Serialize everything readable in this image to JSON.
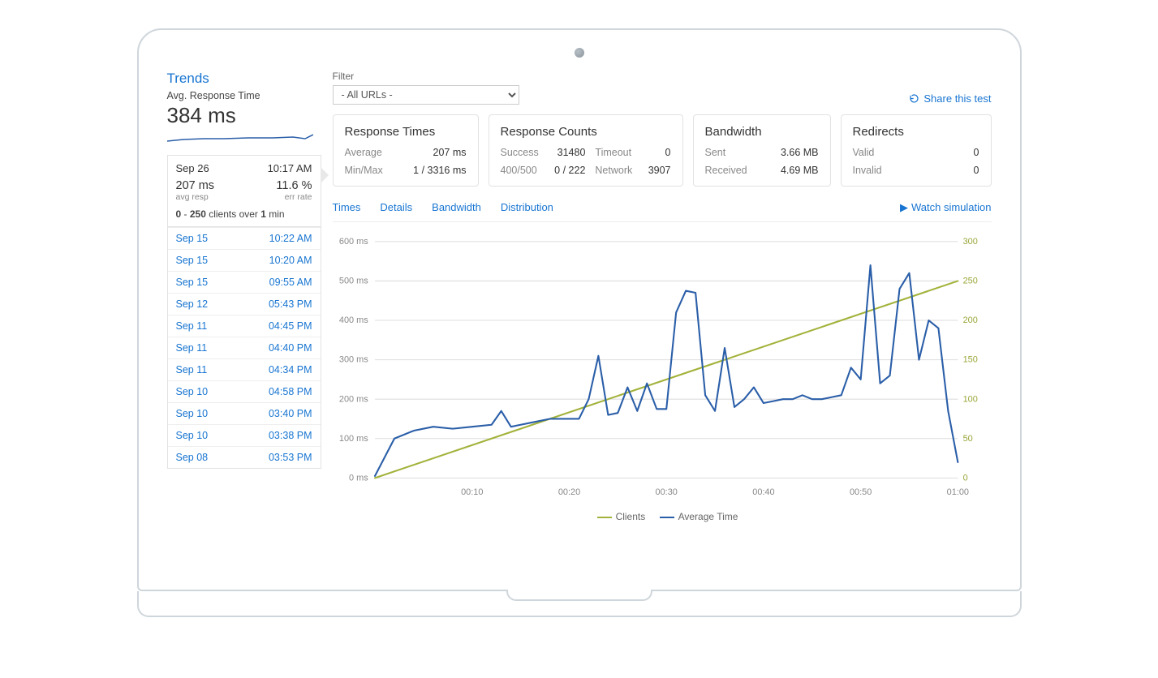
{
  "sidebar": {
    "title": "Trends",
    "avg_label": "Avg. Response Time",
    "avg_value": "384 ms",
    "selected": {
      "date": "Sep 26",
      "time": "10:17 AM",
      "resp_value": "207 ms",
      "resp_label": "avg resp",
      "err_value": "11.6 %",
      "err_label": "err rate",
      "clients_prefix": "0",
      "clients_dash": "  -  ",
      "clients_count": "250",
      "clients_mid": " clients over ",
      "clients_duration": "1",
      "clients_unit": " min"
    },
    "history": [
      {
        "date": "Sep 15",
        "time": "10:22 AM"
      },
      {
        "date": "Sep 15",
        "time": "10:20 AM"
      },
      {
        "date": "Sep 15",
        "time": "09:55 AM"
      },
      {
        "date": "Sep 12",
        "time": "05:43 PM"
      },
      {
        "date": "Sep 11",
        "time": "04:45 PM"
      },
      {
        "date": "Sep 11",
        "time": "04:40 PM"
      },
      {
        "date": "Sep 11",
        "time": "04:34 PM"
      },
      {
        "date": "Sep 10",
        "time": "04:58 PM"
      },
      {
        "date": "Sep 10",
        "time": "03:40 PM"
      },
      {
        "date": "Sep 10",
        "time": "03:38 PM"
      },
      {
        "date": "Sep 08",
        "time": "03:53 PM"
      }
    ]
  },
  "filter": {
    "label": "Filter",
    "selected": "- All URLs -"
  },
  "share_label": "Share this test",
  "cards": {
    "response_times": {
      "title": "Response Times",
      "rows": [
        {
          "k": "Average",
          "v": "207 ms"
        },
        {
          "k": "Min/Max",
          "v": "1 / 3316 ms"
        }
      ]
    },
    "response_counts": {
      "title": "Response Counts",
      "rows": [
        {
          "k": "Success",
          "v": "31480",
          "k2": "Timeout",
          "v2": "0"
        },
        {
          "k": "400/500",
          "v": "0 / 222",
          "k2": "Network",
          "v2": "3907"
        }
      ]
    },
    "bandwidth": {
      "title": "Bandwidth",
      "rows": [
        {
          "k": "Sent",
          "v": "3.66 MB"
        },
        {
          "k": "Received",
          "v": "4.69 MB"
        }
      ]
    },
    "redirects": {
      "title": "Redirects",
      "rows": [
        {
          "k": "Valid",
          "v": "0"
        },
        {
          "k": "Invalid",
          "v": "0"
        }
      ]
    }
  },
  "tabs": [
    "Times",
    "Details",
    "Bandwidth",
    "Distribution"
  ],
  "watch_label": "Watch simulation",
  "legend": {
    "clients": "Clients",
    "avg": "Average Time"
  },
  "chart_data": {
    "type": "line",
    "x_ticks": [
      "00:10",
      "00:20",
      "00:30",
      "00:40",
      "00:50",
      "01:00"
    ],
    "y_left_label_unit": "ms",
    "y_left_ticks": [
      0,
      100,
      200,
      300,
      400,
      500,
      600
    ],
    "y_right_ticks": [
      0,
      50,
      100,
      150,
      200,
      250,
      300
    ],
    "series": [
      {
        "name": "Clients",
        "axis": "right",
        "color": "#a3b23a",
        "points": [
          {
            "x": 0,
            "y": 0
          },
          {
            "x": 60,
            "y": 250
          }
        ]
      },
      {
        "name": "Average Time",
        "axis": "left",
        "color": "#2a5ea8",
        "points": [
          {
            "x": 0,
            "y": 5
          },
          {
            "x": 2,
            "y": 100
          },
          {
            "x": 4,
            "y": 120
          },
          {
            "x": 6,
            "y": 130
          },
          {
            "x": 8,
            "y": 125
          },
          {
            "x": 10,
            "y": 130
          },
          {
            "x": 12,
            "y": 135
          },
          {
            "x": 13,
            "y": 170
          },
          {
            "x": 14,
            "y": 130
          },
          {
            "x": 15,
            "y": 135
          },
          {
            "x": 16,
            "y": 140
          },
          {
            "x": 17,
            "y": 145
          },
          {
            "x": 18,
            "y": 150
          },
          {
            "x": 19,
            "y": 150
          },
          {
            "x": 20,
            "y": 150
          },
          {
            "x": 21,
            "y": 150
          },
          {
            "x": 22,
            "y": 200
          },
          {
            "x": 23,
            "y": 310
          },
          {
            "x": 24,
            "y": 160
          },
          {
            "x": 25,
            "y": 165
          },
          {
            "x": 26,
            "y": 230
          },
          {
            "x": 27,
            "y": 170
          },
          {
            "x": 28,
            "y": 240
          },
          {
            "x": 29,
            "y": 175
          },
          {
            "x": 30,
            "y": 175
          },
          {
            "x": 31,
            "y": 420
          },
          {
            "x": 32,
            "y": 475
          },
          {
            "x": 33,
            "y": 470
          },
          {
            "x": 34,
            "y": 210
          },
          {
            "x": 35,
            "y": 170
          },
          {
            "x": 36,
            "y": 330
          },
          {
            "x": 37,
            "y": 180
          },
          {
            "x": 38,
            "y": 200
          },
          {
            "x": 39,
            "y": 230
          },
          {
            "x": 40,
            "y": 190
          },
          {
            "x": 41,
            "y": 195
          },
          {
            "x": 42,
            "y": 200
          },
          {
            "x": 43,
            "y": 200
          },
          {
            "x": 44,
            "y": 210
          },
          {
            "x": 45,
            "y": 200
          },
          {
            "x": 46,
            "y": 200
          },
          {
            "x": 47,
            "y": 205
          },
          {
            "x": 48,
            "y": 210
          },
          {
            "x": 49,
            "y": 280
          },
          {
            "x": 50,
            "y": 250
          },
          {
            "x": 51,
            "y": 540
          },
          {
            "x": 52,
            "y": 240
          },
          {
            "x": 53,
            "y": 260
          },
          {
            "x": 54,
            "y": 480
          },
          {
            "x": 55,
            "y": 520
          },
          {
            "x": 56,
            "y": 300
          },
          {
            "x": 57,
            "y": 400
          },
          {
            "x": 58,
            "y": 380
          },
          {
            "x": 59,
            "y": 170
          },
          {
            "x": 60,
            "y": 40
          }
        ]
      }
    ]
  }
}
